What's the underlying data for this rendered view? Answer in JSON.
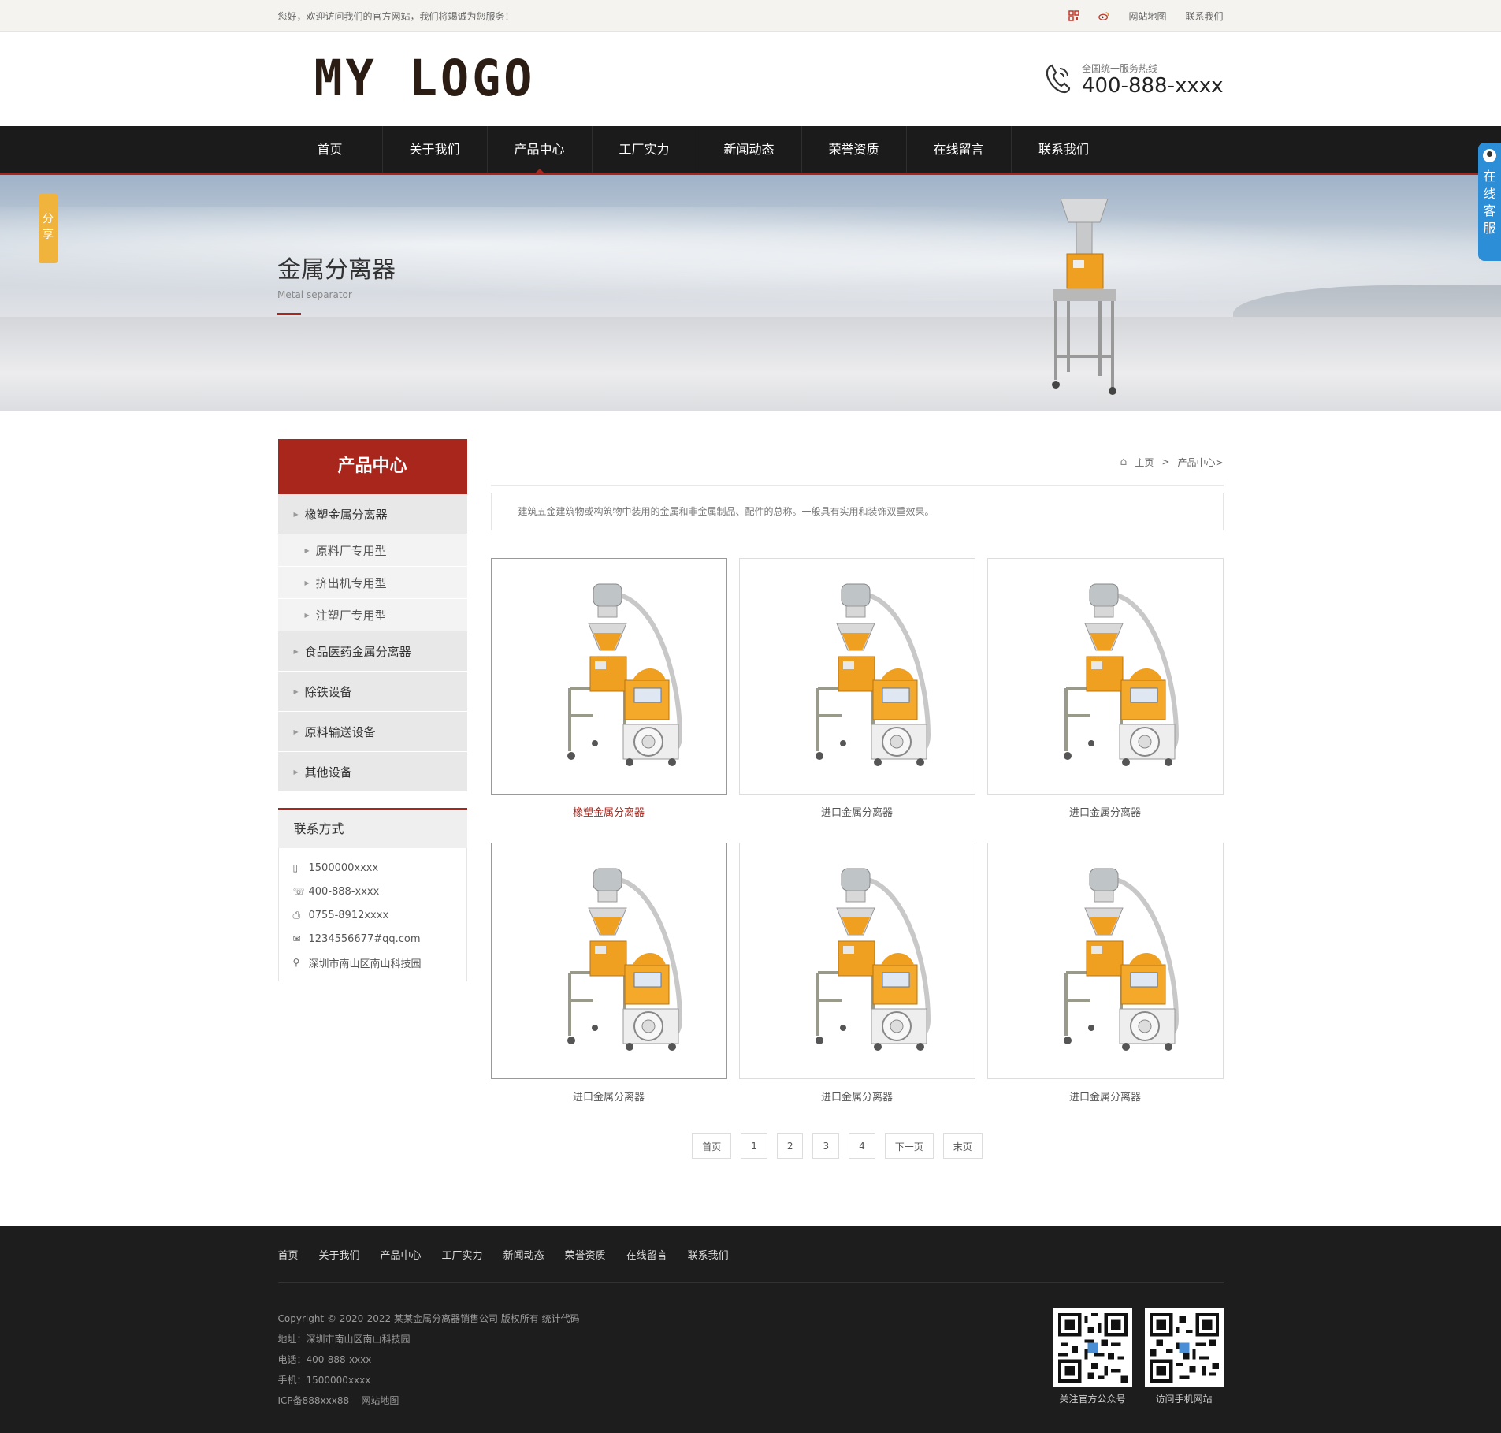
{
  "topbar": {
    "welcome": "您好，欢迎访问我们的官方网站，我们将竭诚为您服务！",
    "sitemap": "网站地图",
    "contact": "联系我们",
    "icons": [
      "qrcode-icon",
      "weibo-icon"
    ]
  },
  "header": {
    "logo": "MY LOGO",
    "hotline_label": "全国统一服务热线",
    "hotline": "400-888-xxxx"
  },
  "nav": {
    "items": [
      "首页",
      "关于我们",
      "产品中心",
      "工厂实力",
      "新闻动态",
      "荣誉资质",
      "在线留言",
      "联系我们"
    ],
    "active_index": 2
  },
  "banner": {
    "title": "金属分离器",
    "subtitle": "Metal separator"
  },
  "widgets": {
    "share": "分享",
    "kefu": "在线客服"
  },
  "sidebar": {
    "title": "产品中心",
    "categories": [
      {
        "label": "橡塑金属分离器",
        "children": [
          "原料厂专用型",
          "挤出机专用型",
          "注塑厂专用型"
        ]
      },
      {
        "label": "食品医药金属分离器"
      },
      {
        "label": "除铁设备"
      },
      {
        "label": "原料输送设备"
      },
      {
        "label": "其他设备"
      }
    ],
    "contact": {
      "title": "联系方式",
      "mobile": "1500000xxxx",
      "phone": "400-888-xxxx",
      "fax": "0755-8912xxxx",
      "email": "1234556677#qq.com",
      "address": "深圳市南山区南山科技园"
    }
  },
  "breadcrumb": {
    "home": "主页",
    "sep": ">",
    "current": "产品中心>"
  },
  "description": "建筑五金建筑物或构筑物中装用的金属和非金属制品、配件的总称。一般具有实用和装饰双重效果。",
  "products": [
    {
      "name": "橡塑金属分离器"
    },
    {
      "name": "进口金属分离器"
    },
    {
      "name": "进口金属分离器"
    },
    {
      "name": "进口金属分离器"
    },
    {
      "name": "进口金属分离器"
    },
    {
      "name": "进口金属分离器"
    }
  ],
  "pagination": [
    "首页",
    "1",
    "2",
    "3",
    "4",
    "下一页",
    "末页"
  ],
  "footer": {
    "nav": [
      "首页",
      "关于我们",
      "产品中心",
      "工厂实力",
      "新闻动态",
      "荣誉资质",
      "在线留言",
      "联系我们"
    ],
    "copyright": "Copyright © 2020-2022 某某金属分离器销售公司 版权所有 统计代码",
    "address": "地址：深圳市南山区南山科技园",
    "phone": "电话：400-888-xxxx",
    "mobile": "手机：1500000xxxx",
    "icp": "ICP备888xxx88",
    "sitemap": "网站地图",
    "qr1": "关注官方公众号",
    "qr2": "访问手机网站"
  },
  "colors": {
    "accent": "#a8261c",
    "nav_bg": "#1b1b1b",
    "footer_bg": "#1d1d1d",
    "machine_orange": "#f0a020"
  }
}
